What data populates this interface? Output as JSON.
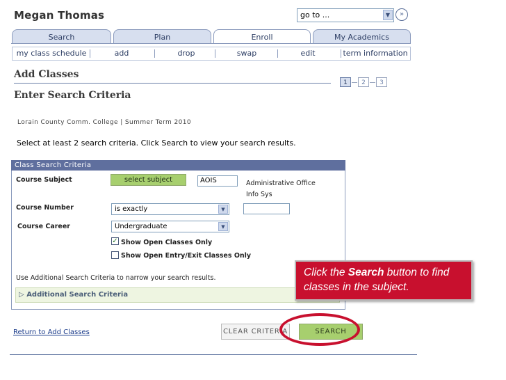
{
  "header": {
    "user_name": "Megan Thomas",
    "goto_value": "go to ...",
    "goto_arrow": "▼",
    "goto_button": "»"
  },
  "tabs": [
    {
      "label": "Search"
    },
    {
      "label": "Plan"
    },
    {
      "label": "Enroll",
      "active": true
    },
    {
      "label": "My Academics"
    }
  ],
  "subnav": [
    {
      "label": "my class schedule"
    },
    {
      "label": "add"
    },
    {
      "label": "drop"
    },
    {
      "label": "swap"
    },
    {
      "label": "edit"
    },
    {
      "label": "term information"
    }
  ],
  "page": {
    "title": "Add Classes",
    "steps": [
      "1",
      "2",
      "3"
    ],
    "active_step": 1,
    "subtitle": "Enter Search Criteria",
    "college_term": "Lorain County Comm. College | Summer Term 2010",
    "instructions": "Select at least 2 search criteria. Click Search to view your search results."
  },
  "criteria": {
    "header": "Class Search Criteria",
    "course_subject_label": "Course Subject",
    "select_subject_button": "select subject",
    "subject_code": "AOIS",
    "subject_desc": "Administrative Office Info Sys",
    "course_number_label": "Course Number",
    "course_number_operator": "is exactly",
    "course_number_value": "",
    "course_career_label": "Course Career",
    "course_career_value": "Undergraduate",
    "dropdown_arrow": "▼",
    "show_open_label": "Show Open Classes Only",
    "show_open_checked": true,
    "check_mark": "✓",
    "show_open_entry_label": "Show Open Entry/Exit Classes Only",
    "show_open_entry_checked": false,
    "additional_help": "Use Additional Search Criteria to narrow your search results.",
    "additional_toggle": "▷",
    "additional_label": "Additional Search Criteria"
  },
  "callout": {
    "prefix": "Click the ",
    "bold": "Search",
    "suffix": " button to find classes in the subject."
  },
  "footer": {
    "return_link": "Return to Add Classes",
    "clear_button": "CLEAR CRITERIA",
    "search_button": "SEARCH"
  },
  "colors": {
    "tab_bg": "#d7dfef",
    "criteria_header_bg": "#5f6f9e",
    "green_button": "#a7cf6e",
    "callout_red": "#c8102e",
    "link_blue": "#1a3b8a"
  }
}
